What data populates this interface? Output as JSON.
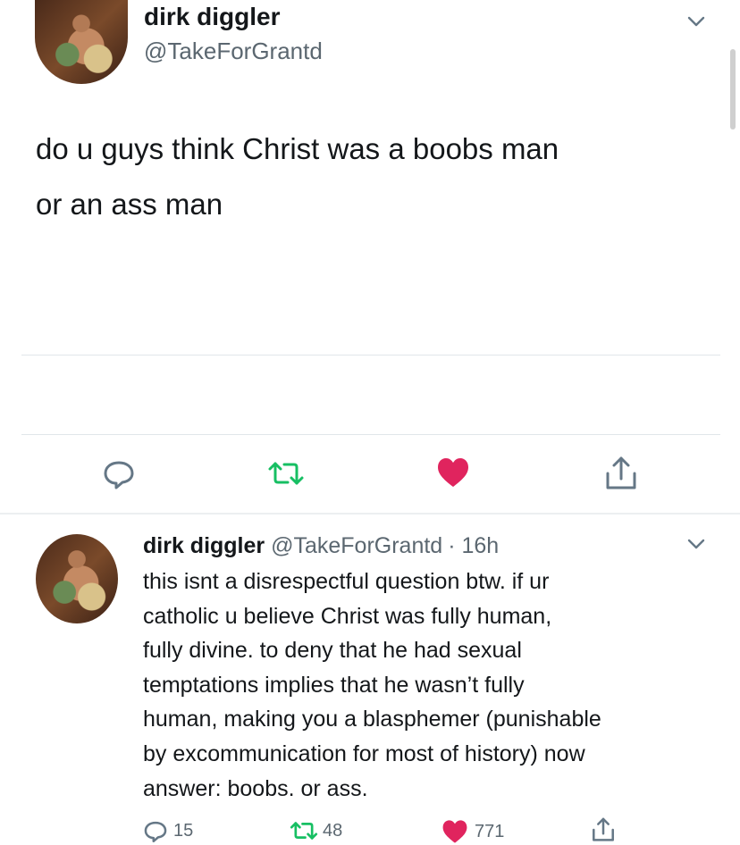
{
  "tweet": {
    "display_name": "dirk diggler",
    "handle": "@TakeForGrantd",
    "text_line1": "do u guys think Christ was a boobs man",
    "text_line2": "or an ass man"
  },
  "reply": {
    "display_name": "dirk diggler",
    "handle": "@TakeForGrantd",
    "time": "· 16h",
    "lines": [
      "this isnt a disrespectful question btw. if ur",
      "catholic u believe Christ was fully human,",
      "fully divine. to deny that he had sexual",
      "temptations implies that he wasn’t fully",
      "human, making you a blasphemer (punishable",
      "by excommunication for most of history) now",
      "answer: boobs. or ass."
    ],
    "reply_count": "15",
    "retweet_count": "48",
    "like_count": "771"
  },
  "colors": {
    "retweet_green": "#17bf63",
    "like_red": "#e0245e",
    "icon_gray": "#657786"
  }
}
